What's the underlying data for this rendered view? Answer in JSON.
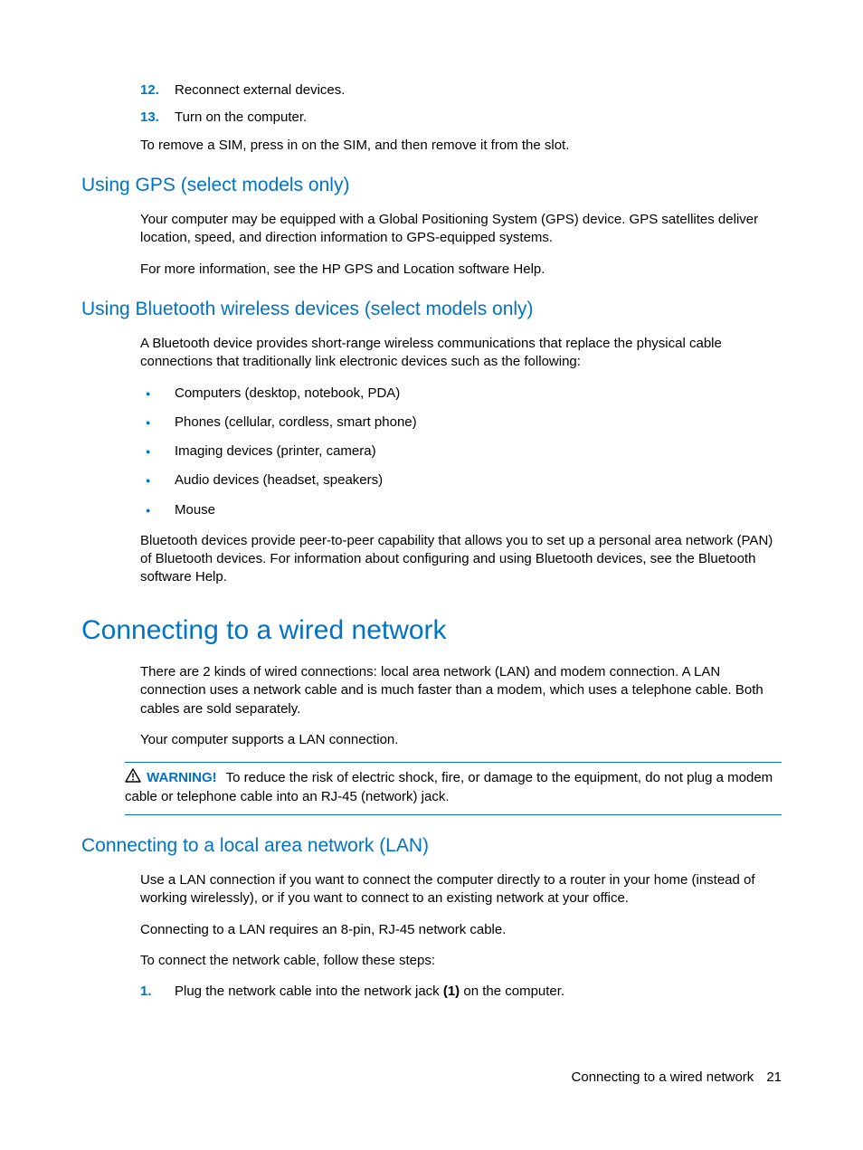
{
  "ordered": {
    "step12": {
      "num": "12.",
      "text": "Reconnect external devices."
    },
    "step13": {
      "num": "13.",
      "text": "Turn on the computer."
    }
  },
  "sim_remove": "To remove a SIM, press in on the SIM, and then remove it from the slot.",
  "gps": {
    "heading": "Using GPS (select models only)",
    "p1": "Your computer may be equipped with a Global Positioning System (GPS) device. GPS satellites deliver location, speed, and direction information to GPS-equipped systems.",
    "p2": "For more information, see the HP GPS and Location software Help."
  },
  "bt": {
    "heading": "Using Bluetooth wireless devices (select models only)",
    "p1": "A Bluetooth device provides short-range wireless communications that replace the physical cable connections that traditionally link electronic devices such as the following:",
    "b1": "Computers (desktop, notebook, PDA)",
    "b2": "Phones (cellular, cordless, smart phone)",
    "b3": "Imaging devices (printer, camera)",
    "b4": "Audio devices (headset, speakers)",
    "b5": "Mouse",
    "p2": "Bluetooth devices provide peer-to-peer capability that allows you to set up a personal area network (PAN) of Bluetooth devices. For information about configuring and using Bluetooth devices, see the Bluetooth software Help."
  },
  "wired": {
    "heading": "Connecting to a wired network",
    "p1": "There are 2 kinds of wired connections: local area network (LAN) and modem connection. A LAN connection uses a network cable and is much faster than a modem, which uses a telephone cable. Both cables are sold separately.",
    "p2": "Your computer supports a LAN connection."
  },
  "warning": {
    "label": "WARNING!",
    "text": "To reduce the risk of electric shock, fire, or damage to the equipment, do not plug a modem cable or telephone cable into an RJ-45 (network) jack."
  },
  "lan": {
    "heading": "Connecting to a local area network (LAN)",
    "p1": "Use a LAN connection if you want to connect the computer directly to a router in your home (instead of working wirelessly), or if you want to connect to an existing network at your office.",
    "p2": "Connecting to a LAN requires an 8-pin, RJ-45 network cable.",
    "p3": "To connect the network cable, follow these steps:",
    "step1": {
      "num": "1.",
      "pre": "Plug the network cable into the network jack ",
      "bold": "(1)",
      "post": " on the computer."
    }
  },
  "footer": {
    "title": "Connecting to a wired network",
    "page": "21"
  }
}
